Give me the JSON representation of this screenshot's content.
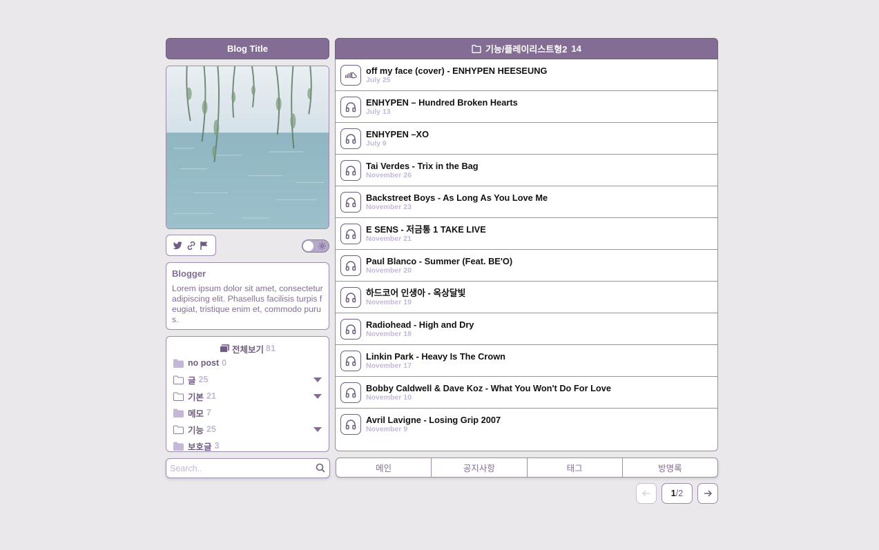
{
  "sidebar": {
    "blog_title": "Blog Title",
    "blogger_name": "Blogger",
    "blogger_desc": "Lorem ipsum dolor sit amet, consectetur adipiscing elit. Phasellus facilisis turpis feugiat, tristique enim et, commodo purus.",
    "categories_all_label": "전체보기",
    "categories_all_count": "81",
    "categories": [
      {
        "label": "no post",
        "count": "0",
        "icon": "folder-filled-icon",
        "expandable": false
      },
      {
        "label": "글",
        "count": "25",
        "icon": "folder-outline-icon",
        "expandable": true
      },
      {
        "label": "기본",
        "count": "21",
        "icon": "folder-outline-icon",
        "expandable": true
      },
      {
        "label": "메모",
        "count": "7",
        "icon": "folder-filled-icon",
        "expandable": false
      },
      {
        "label": "기능",
        "count": "25",
        "icon": "folder-outline-icon",
        "expandable": true
      },
      {
        "label": "보호글",
        "count": "3",
        "icon": "folder-filled-icon",
        "expandable": false
      }
    ],
    "search_placeholder": "Search.."
  },
  "main": {
    "header_title": "기능/플레이리스트형2",
    "header_count": "14",
    "posts": [
      {
        "title": "off my face (cover) - ENHYPEN HEESEUNG",
        "date": "July 25",
        "icon": "soundcloud-icon"
      },
      {
        "title": "ENHYPEN – Hundred Broken Hearts",
        "date": "July 13",
        "icon": "headphones-icon"
      },
      {
        "title": "ENHYPEN –XO",
        "date": "July 9",
        "icon": "headphones-icon"
      },
      {
        "title": "Tai Verdes - Trix in the Bag",
        "date": "November 26",
        "icon": "headphones-icon"
      },
      {
        "title": "Backstreet Boys - As Long As You Love Me",
        "date": "November 23",
        "icon": "headphones-icon"
      },
      {
        "title": "E SENS - 저금통 1 TAKE LIVE",
        "date": "November 21",
        "icon": "headphones-icon"
      },
      {
        "title": "Paul Blanco - Summer (Feat. BE'O)",
        "date": "November 20",
        "icon": "headphones-icon"
      },
      {
        "title": "하드코어 인생아 - 옥상달빛",
        "date": "November 19",
        "icon": "headphones-icon"
      },
      {
        "title": "Radiohead - High and Dry",
        "date": "November 18",
        "icon": "headphones-icon"
      },
      {
        "title": "Linkin Park - Heavy Is The Crown",
        "date": "November 17",
        "icon": "headphones-icon"
      },
      {
        "title": "Bobby Caldwell & Dave Koz - What You Won't Do For Love",
        "date": "November 10",
        "icon": "headphones-icon"
      },
      {
        "title": "Avril Lavigne - Losing Grip 2007",
        "date": "November 9",
        "icon": "headphones-icon"
      }
    ],
    "nav_tabs": [
      "메인",
      "공지사항",
      "태그",
      "방명록"
    ],
    "pager": {
      "current": "1",
      "total": "/2"
    }
  },
  "colors": {
    "accent": "#836d95",
    "background": "#ebe8ec",
    "muted": "#c4b8d6"
  }
}
